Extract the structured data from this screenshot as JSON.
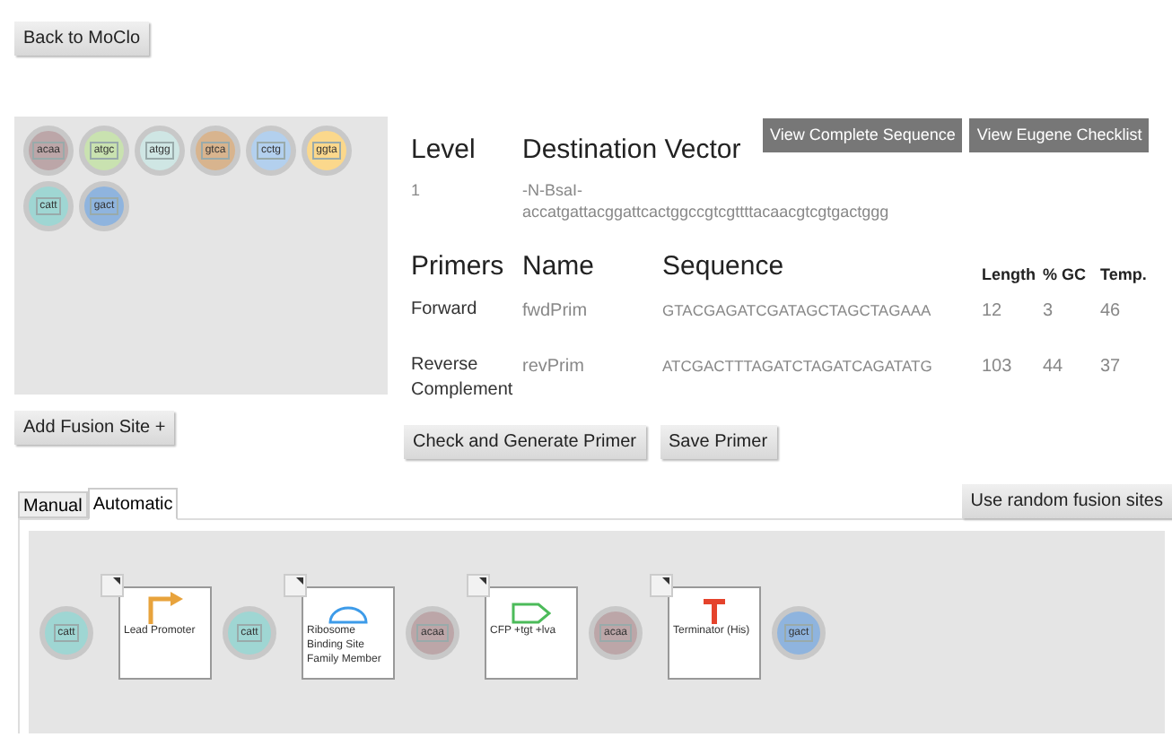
{
  "back_button": "Back to MoClo",
  "fusion_sites": [
    {
      "label": "acaa",
      "color": "#bca6a8"
    },
    {
      "label": "atgc",
      "color": "#c9e2b0"
    },
    {
      "label": "atgg",
      "color": "#cfe6e4"
    },
    {
      "label": "gtca",
      "color": "#d8b48e"
    },
    {
      "label": "cctg",
      "color": "#b3d0ee"
    },
    {
      "label": "ggta",
      "color": "#fbd88c"
    },
    {
      "label": "catt",
      "color": "#9fd6d3"
    },
    {
      "label": "gact",
      "color": "#8fb4de"
    }
  ],
  "add_fusion_site": "Add Fusion Site +",
  "level": {
    "heading": "Level",
    "value": "1"
  },
  "destination_vector": {
    "heading": "Destination Vector",
    "value": "-N-BsaI-accatgattacggattcactggccgtcgttttacaacgtcgtgactggg"
  },
  "view_buttons": [
    "View Complete Sequence",
    "View Eugene Checklist"
  ],
  "primers": {
    "columns": [
      "Primers",
      "Name",
      "Sequence",
      "Length",
      "% GC",
      "Temp."
    ],
    "rows": [
      {
        "direction": "Forward",
        "name": "fwdPrim",
        "sequence": "GTACGAGATCGATAGCTAGCTAGAAA",
        "length": "12",
        "gc": "3",
        "temp": "46"
      },
      {
        "direction": "Reverse Complement",
        "name": "revPrim",
        "sequence": "ATCGACTTTAGATCTAGATCAGATATG",
        "length": "103",
        "gc": "44",
        "temp": "37"
      }
    ]
  },
  "primer_buttons": [
    "Check and Generate Primer",
    "Save Primer"
  ],
  "tabs": [
    {
      "label": "Manual",
      "selected": false
    },
    {
      "label": "Automatic",
      "selected": true
    }
  ],
  "random_button": "Use random fusion sites",
  "construct": [
    {
      "kind": "site",
      "label": "catt",
      "color": "#9fd6d3"
    },
    {
      "kind": "promoter",
      "label": "Lead Promoter"
    },
    {
      "kind": "site",
      "label": "catt",
      "color": "#9fd6d3"
    },
    {
      "kind": "rbs",
      "label": "Ribosome Binding Site Family Member"
    },
    {
      "kind": "site",
      "label": "acaa",
      "color": "#bca6a8"
    },
    {
      "kind": "cds",
      "label": "CFP +tgt +lva"
    },
    {
      "kind": "site",
      "label": "acaa",
      "color": "#bca6a8"
    },
    {
      "kind": "terminator",
      "label": "Terminator (His)"
    },
    {
      "kind": "site",
      "label": "gact",
      "color": "#8fb4de"
    }
  ]
}
